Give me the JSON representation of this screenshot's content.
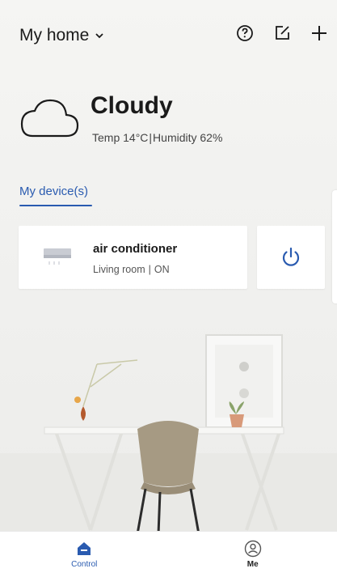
{
  "header": {
    "home_title": "My home",
    "icons": [
      "help-icon",
      "edit-icon",
      "add-icon"
    ]
  },
  "weather": {
    "condition": "Cloudy",
    "temp": "Temp 14°C",
    "separator": "|",
    "humidity": "Humidity 62%",
    "icon": "cloud-icon"
  },
  "tabs": {
    "devices_label": "My device(s)"
  },
  "device": {
    "name": "air conditioner",
    "room": "Living room",
    "separator": "|",
    "state": "ON",
    "icon": "air-conditioner-icon"
  },
  "nav": {
    "control_label": "Control",
    "me_label": "Me"
  },
  "colors": {
    "accent": "#2a5bb0",
    "background": "#f3f3f1"
  }
}
